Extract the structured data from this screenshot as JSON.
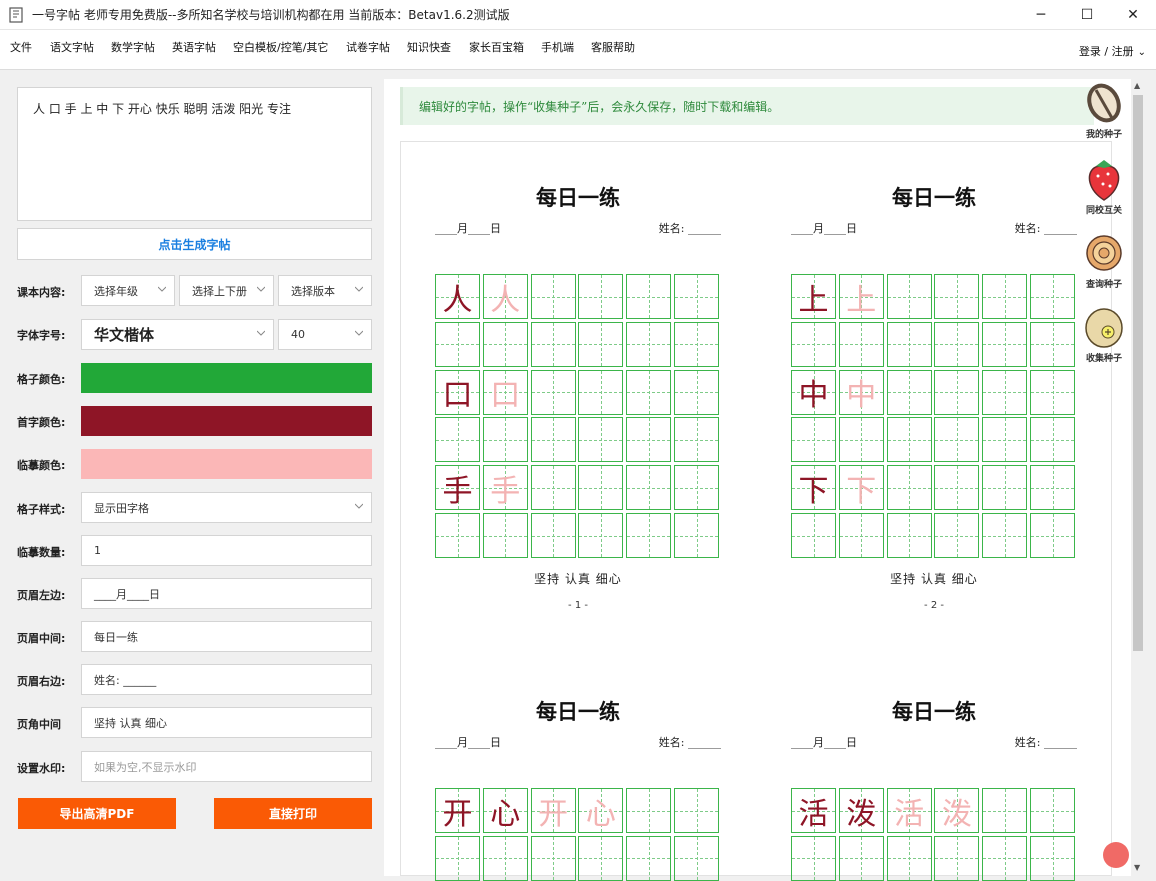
{
  "window": {
    "title": "一号字帖    老师专用免费版--多所知名学校与培训机构都在用 当前版本：Betav1.6.2测试版",
    "minimize": "─",
    "maximize": "☐",
    "close": "✕"
  },
  "menu": {
    "items": [
      "文件",
      "语文字帖",
      "数学字帖",
      "英语字帖",
      "空白模板/控笔/其它",
      "试卷字帖",
      "知识快查",
      "家长百宝箱",
      "手机端",
      "客服帮助"
    ],
    "login": "登录 / 注册"
  },
  "editor": {
    "text": "人 口 手 上 中 下 开心 快乐 聪明 活泼 阳光 专注",
    "generate_button": "点击生成字帖"
  },
  "form": {
    "course_label": "课本内容:",
    "grade": "选择年级",
    "volume": "选择上下册",
    "edition": "选择版本",
    "font_label": "字体字号:",
    "font": "华文楷体",
    "size": "40",
    "grid_color_label": "格子颜色:",
    "first_color_label": "首字颜色:",
    "trace_color_label": "临摹颜色:",
    "grid_style_label": "格子样式:",
    "grid_style": "显示田字格",
    "trace_count_label": "临摹数量:",
    "trace_count": "1",
    "header_left_label": "页眉左边:",
    "header_left": "____月____日",
    "header_center_label": "页眉中间:",
    "header_center": "每日一练",
    "header_right_label": "页眉右边:",
    "header_right": "姓名: ______",
    "footer_center_label": "页角中间",
    "footer_center": "坚持  认真  细心",
    "watermark_label": "设置水印:",
    "watermark_placeholder": "如果为空,不显示水印",
    "export_button": "导出高清PDF",
    "print_button": "直接打印"
  },
  "colors": {
    "grid": "#22a838",
    "first_char": "#8e1526",
    "trace": "#fbb7b7",
    "accent": "#fa5a05",
    "link": "#1a7fe0"
  },
  "preview": {
    "notice": "编辑好的字帖，操作“收集种子”后，会永久保存，随时下载和编辑。",
    "sheets": [
      {
        "title": "每日一练",
        "date": "____月____日",
        "name": "姓名: ______",
        "footer": "坚持  认真  细心",
        "page": "- 1 -",
        "rows": [
          [
            "人",
            "人"
          ],
          [],
          [
            "口",
            "口"
          ],
          [],
          [
            "手",
            "手"
          ],
          []
        ]
      },
      {
        "title": "每日一练",
        "date": "____月____日",
        "name": "姓名: ______",
        "footer": "坚持  认真  细心",
        "page": "- 2 -",
        "rows": [
          [
            "上",
            "上"
          ],
          [],
          [
            "中",
            "中"
          ],
          [],
          [
            "下",
            "下"
          ],
          []
        ]
      },
      {
        "title": "每日一练",
        "date": "____月____日",
        "name": "姓名: ______",
        "footer": "",
        "page": "",
        "rows": [
          [
            "开",
            "心",
            "开",
            "心"
          ],
          []
        ]
      },
      {
        "title": "每日一练",
        "date": "____月____日",
        "name": "姓名: ______",
        "footer": "",
        "page": "",
        "rows": [
          [
            "活",
            "泼",
            "活",
            "泼"
          ],
          []
        ]
      }
    ]
  },
  "side_tools": [
    {
      "label": "我的种子",
      "icon": "seed-icon"
    },
    {
      "label": "同校互关",
      "icon": "strawberry-icon"
    },
    {
      "label": "查询种子",
      "icon": "search-seed-icon"
    },
    {
      "label": "收集种子",
      "icon": "collect-seed-icon"
    }
  ]
}
